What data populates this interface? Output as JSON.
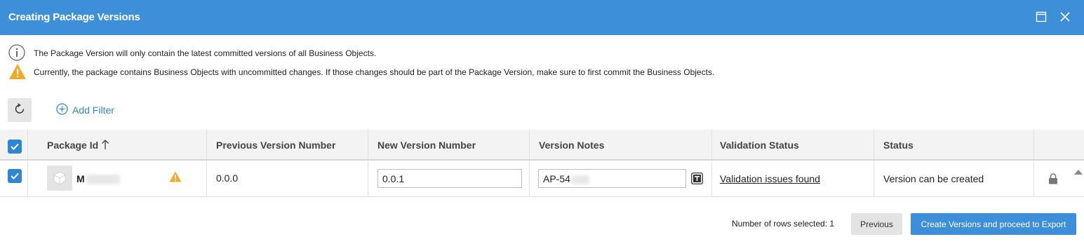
{
  "window": {
    "title": "Creating Package Versions",
    "maximize_icon": "maximize-icon",
    "close_icon": "close-icon"
  },
  "notices": [
    {
      "icon": "info-icon",
      "text": "The Package Version will only contain the latest committed versions of all Business Objects."
    },
    {
      "icon": "warning-icon",
      "text": "Currently, the package contains Business Objects with uncommitted changes. If those changes should be part of the Package Version, make sure to first commit the Business Objects."
    }
  ],
  "toolbar": {
    "refresh_icon": "refresh-icon",
    "add_filter_label": "Add Filter"
  },
  "table": {
    "columns": [
      {
        "label": "Package Id",
        "sort": "ascending"
      },
      {
        "label": "Previous Version Number"
      },
      {
        "label": "New Version Number"
      },
      {
        "label": "Version Notes"
      },
      {
        "label": "Validation Status"
      },
      {
        "label": "Status"
      }
    ],
    "rows": [
      {
        "selected": true,
        "package_id": "M",
        "has_warning": true,
        "previous_version": "0.0.0",
        "new_version": "0.0.1",
        "version_notes": "AP-54",
        "validation_status": "Validation issues found",
        "status": "Version can be created",
        "locked": true
      }
    ]
  },
  "footer": {
    "rows_selected": "Number of rows selected: 1",
    "previous_label": "Previous",
    "primary_label": "Create Versions and proceed to Export"
  },
  "colors": {
    "accent": "#3d8fd9",
    "warning": "#f0a92b"
  }
}
